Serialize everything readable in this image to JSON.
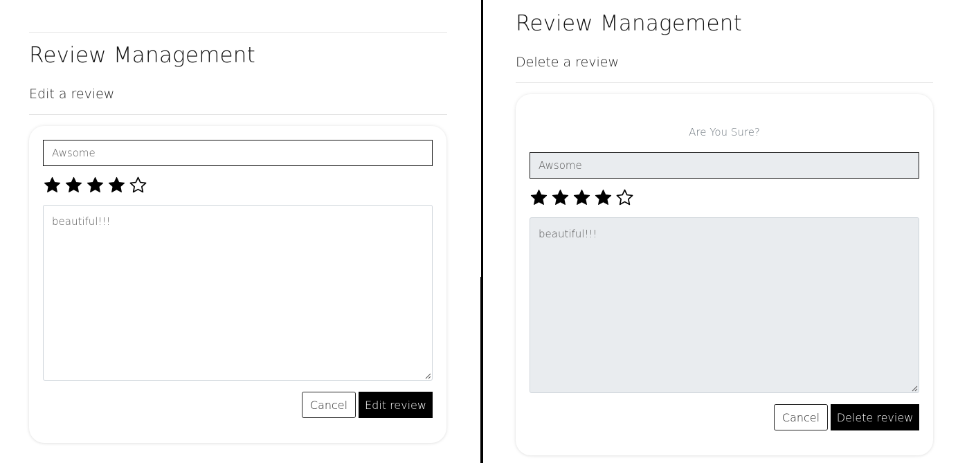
{
  "edit_view": {
    "page_title": "Review Management",
    "subtitle": "Edit a review",
    "form": {
      "title_value": "Awsome",
      "rating": 4,
      "max_rating": 5,
      "review_text": "beautiful!!!",
      "cancel_label": "Cancel",
      "submit_label": "Edit review"
    }
  },
  "delete_view": {
    "page_title": "Review Management",
    "subtitle": "Delete a review",
    "confirm_text": "Are You Sure?",
    "form": {
      "title_value": "Awsome",
      "rating": 4,
      "max_rating": 5,
      "review_text": "beautiful!!!",
      "cancel_label": "Cancel",
      "submit_label": "Delete review"
    }
  },
  "icons": {
    "star_filled": "star-filled-icon",
    "star_empty": "star-outline-icon",
    "resize": "resize-grip-icon"
  },
  "colors": {
    "primary_button": "#000000",
    "readonly_background": "#e9ecef",
    "muted_text": "#6c757d"
  }
}
